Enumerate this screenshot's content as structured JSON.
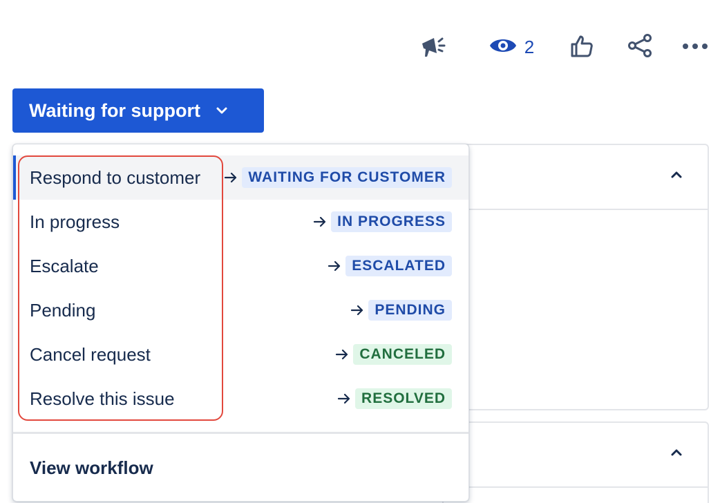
{
  "toolbar": {
    "watch_count": "2"
  },
  "status_button": {
    "label": "Waiting for support"
  },
  "transitions": [
    {
      "label": "Respond to customer",
      "target": "WAITING FOR CUSTOMER",
      "color": "blue",
      "active": true
    },
    {
      "label": "In progress",
      "target": "IN PROGRESS",
      "color": "blue"
    },
    {
      "label": "Escalate",
      "target": "ESCALATED",
      "color": "blue"
    },
    {
      "label": "Pending",
      "target": "PENDING",
      "color": "blue"
    },
    {
      "label": "Cancel request",
      "target": "CANCELED",
      "color": "green"
    },
    {
      "label": "Resolve this issue",
      "target": "RESOLVED",
      "color": "green"
    }
  ],
  "footer": {
    "view_workflow": "View workflow"
  },
  "colors": {
    "primary": "#1d58d4",
    "lozenge_blue_bg": "#e2ebfd",
    "lozenge_blue_text": "#1f4ba8",
    "lozenge_green_bg": "#e0f6e8",
    "lozenge_green_text": "#216e3e",
    "highlight": "#e2483d"
  },
  "icons": [
    "megaphone-icon",
    "eye-icon",
    "thumbs-up-icon",
    "share-icon",
    "more-icon",
    "chevron-down-icon",
    "chevron-up-icon",
    "arrow-right-icon"
  ]
}
